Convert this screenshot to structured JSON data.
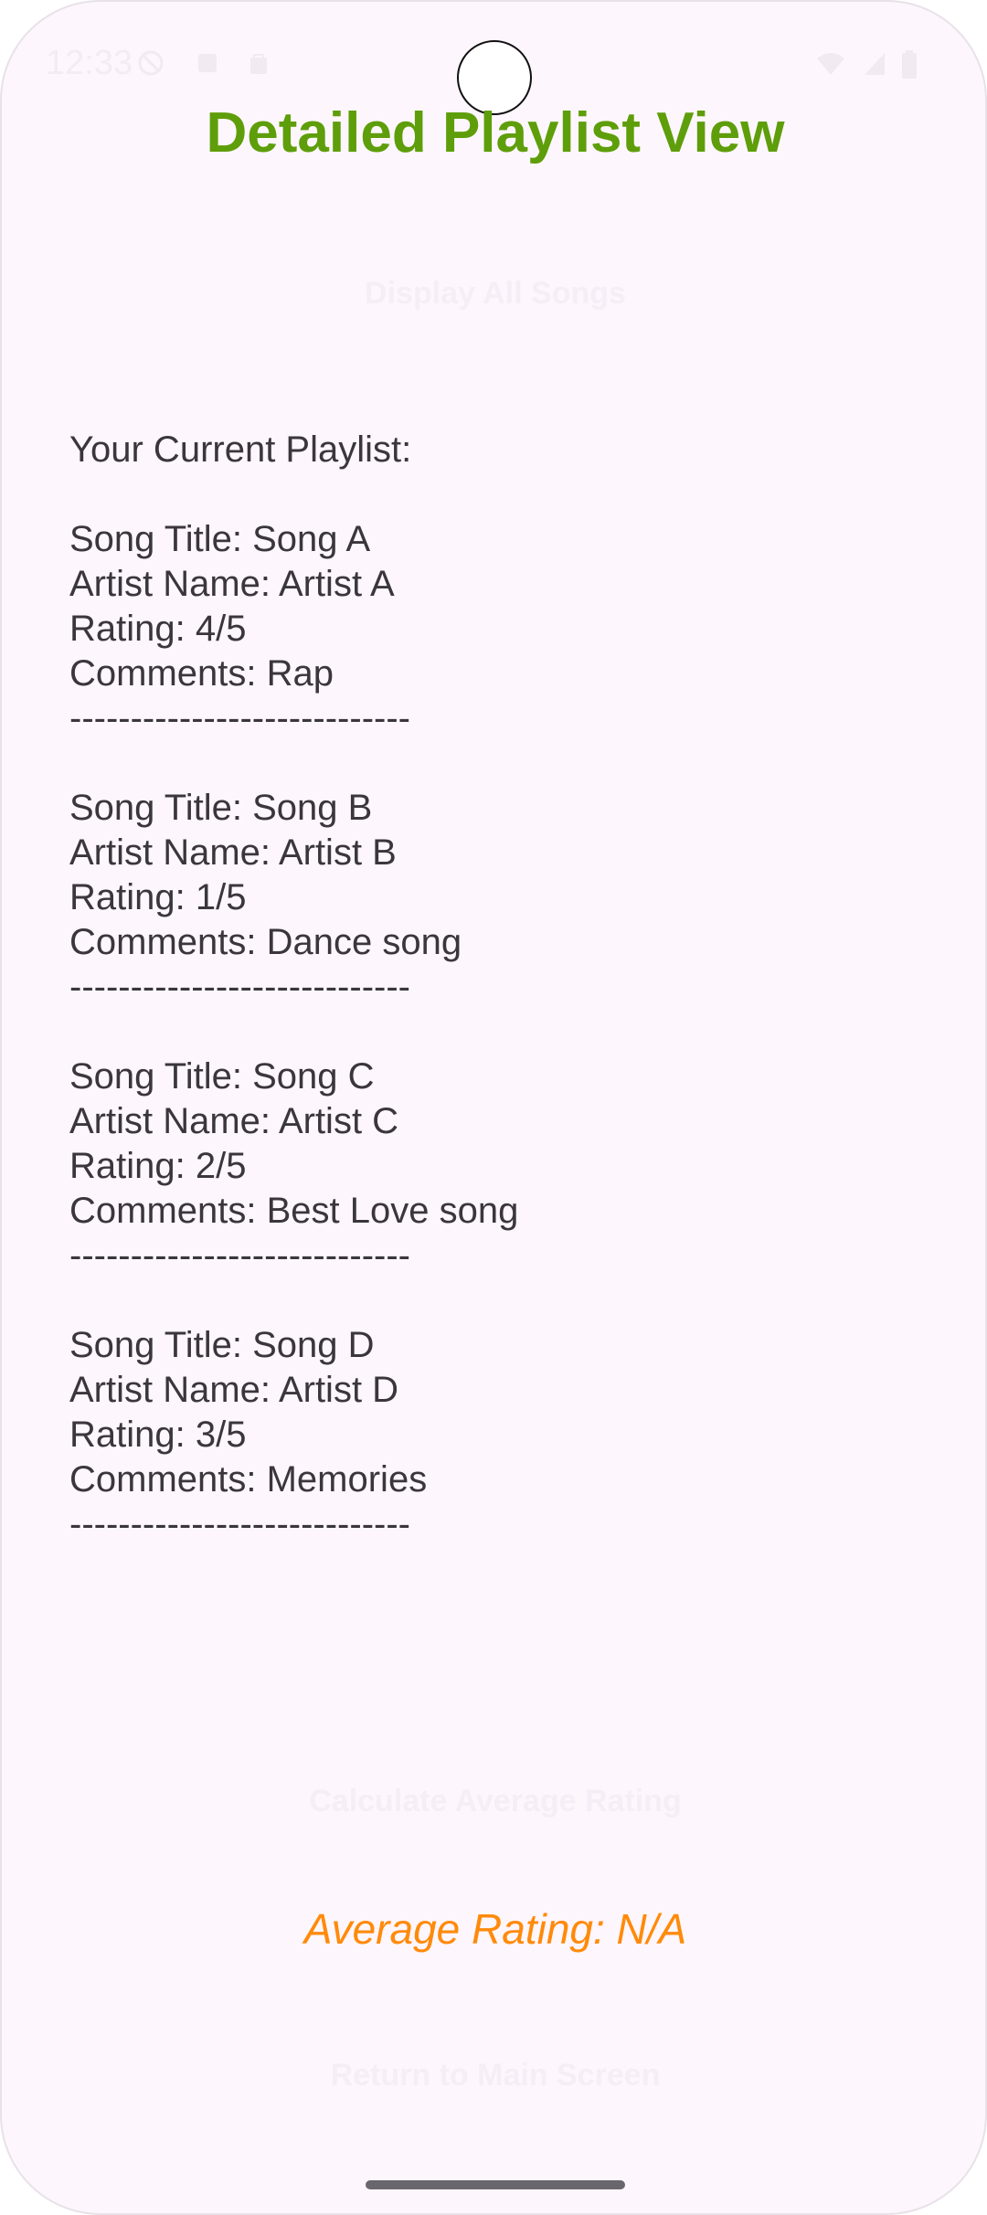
{
  "status_bar": {
    "time": "12:33",
    "icons": [
      "do-not-disturb-icon",
      "sd-card-icon",
      "bag-icon",
      "wifi-icon",
      "signal-icon",
      "battery-icon"
    ]
  },
  "header": {
    "title": "Detailed Playlist View"
  },
  "buttons": {
    "display_all": "Display All Songs",
    "calculate_avg": "Calculate Average Rating",
    "return_main": "Return to Main Screen"
  },
  "playlist": {
    "heading": "Your Current Playlist:",
    "separator": "----------------------------",
    "songs": [
      {
        "title": "Song Title: Song A",
        "artist": "Artist Name: Artist A",
        "rating": "Rating: 4/5",
        "comments": "Comments: Rap"
      },
      {
        "title": "Song Title: Song B",
        "artist": "Artist Name: Artist B",
        "rating": "Rating: 1/5",
        "comments": "Comments: Dance song"
      },
      {
        "title": "Song Title: Song C",
        "artist": "Artist Name: Artist C",
        "rating": "Rating: 2/5",
        "comments": "Comments: Best Love song"
      },
      {
        "title": "Song Title: Song D",
        "artist": "Artist Name: Artist D",
        "rating": "Rating: 3/5",
        "comments": "Comments: Memories"
      }
    ]
  },
  "average": {
    "label": "Average Rating: N/A"
  },
  "colors": {
    "title": "#5e9e0a",
    "average": "#ff8a0a",
    "background": "#fdf6fc",
    "text": "#3b363e"
  }
}
